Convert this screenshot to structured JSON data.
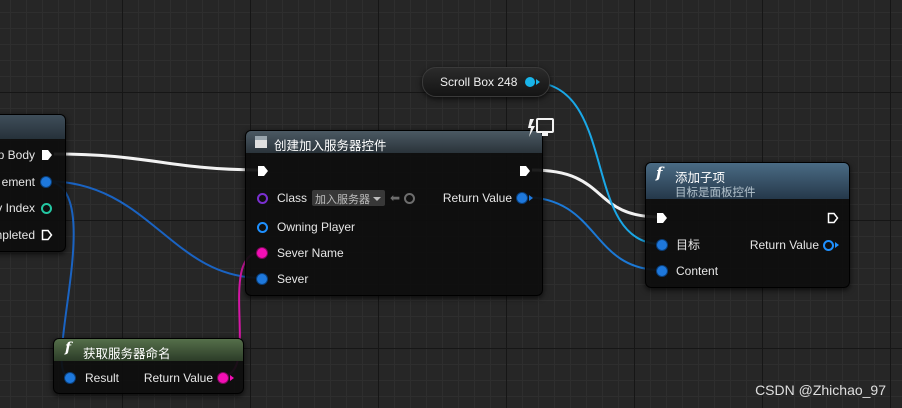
{
  "scroll_box_node": {
    "label": "Scroll Box 248"
  },
  "left_node": {
    "pins": [
      "p Body",
      "ement",
      "y Index",
      "mpleted"
    ]
  },
  "create_widget_node": {
    "title": "创建加入服务器控件",
    "class_label": "Class",
    "class_value": "加入服务器",
    "owning_player_label": "Owning Player",
    "sever_name_label": "Sever Name",
    "sever_label": "Sever",
    "return_value_label": "Return Value"
  },
  "add_child_node": {
    "title": "添加子项",
    "subtitle": "目标是面板控件",
    "target_label": "目标",
    "content_label": "Content",
    "return_value_label": "Return Value"
  },
  "get_server_name_node": {
    "title": "获取服务器命名",
    "result_label": "Result",
    "return_value_label": "Return Value"
  },
  "watermark": {
    "text": "CSDN @Zhichao_97"
  },
  "colors": {
    "exec": "#ffffff",
    "object_pin": "#1e78dc",
    "string_pin": "#f20fb4",
    "function_header": "#4a6a82",
    "pure_header": "#4f6b44",
    "construct_header": "#3c4a55"
  },
  "icons": {
    "function": "function-f-icon",
    "latent": "monitor-icon",
    "dropdown": "chevron-down-icon",
    "use": "arrow-left-icon",
    "browse": "search-icon"
  }
}
